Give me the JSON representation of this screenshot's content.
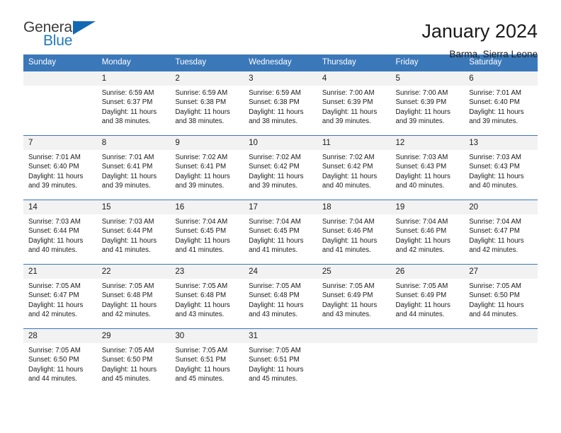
{
  "logo": {
    "text_primary": "General",
    "text_secondary": "Blue",
    "icon": "triangle-icon",
    "color_primary": "#3c3c3c",
    "color_secondary": "#2079c3",
    "triangle_color": "#1268b3"
  },
  "header": {
    "title": "January 2024",
    "location": "Barma, Sierra Leone"
  },
  "theme": {
    "header_bg": "#3b78b9",
    "header_text": "#ffffff",
    "daynum_bg": "#f2f2f2",
    "cell_bg": "#ffffff",
    "row_border": "#3b78b9"
  },
  "weekdays": [
    "Sunday",
    "Monday",
    "Tuesday",
    "Wednesday",
    "Thursday",
    "Friday",
    "Saturday"
  ],
  "labels": {
    "sunrise_prefix": "Sunrise:",
    "sunset_prefix": "Sunset:",
    "daylight_prefix": "Daylight:"
  },
  "weeks": [
    [
      {
        "day": "",
        "line1": "",
        "line2": "",
        "line3": "",
        "line4": "",
        "blank": true
      },
      {
        "day": "1",
        "line1": "Sunrise: 6:59 AM",
        "line2": "Sunset: 6:37 PM",
        "line3": "Daylight: 11 hours",
        "line4": "and 38 minutes."
      },
      {
        "day": "2",
        "line1": "Sunrise: 6:59 AM",
        "line2": "Sunset: 6:38 PM",
        "line3": "Daylight: 11 hours",
        "line4": "and 38 minutes."
      },
      {
        "day": "3",
        "line1": "Sunrise: 6:59 AM",
        "line2": "Sunset: 6:38 PM",
        "line3": "Daylight: 11 hours",
        "line4": "and 38 minutes."
      },
      {
        "day": "4",
        "line1": "Sunrise: 7:00 AM",
        "line2": "Sunset: 6:39 PM",
        "line3": "Daylight: 11 hours",
        "line4": "and 39 minutes."
      },
      {
        "day": "5",
        "line1": "Sunrise: 7:00 AM",
        "line2": "Sunset: 6:39 PM",
        "line3": "Daylight: 11 hours",
        "line4": "and 39 minutes."
      },
      {
        "day": "6",
        "line1": "Sunrise: 7:01 AM",
        "line2": "Sunset: 6:40 PM",
        "line3": "Daylight: 11 hours",
        "line4": "and 39 minutes."
      }
    ],
    [
      {
        "day": "7",
        "line1": "Sunrise: 7:01 AM",
        "line2": "Sunset: 6:40 PM",
        "line3": "Daylight: 11 hours",
        "line4": "and 39 minutes."
      },
      {
        "day": "8",
        "line1": "Sunrise: 7:01 AM",
        "line2": "Sunset: 6:41 PM",
        "line3": "Daylight: 11 hours",
        "line4": "and 39 minutes."
      },
      {
        "day": "9",
        "line1": "Sunrise: 7:02 AM",
        "line2": "Sunset: 6:41 PM",
        "line3": "Daylight: 11 hours",
        "line4": "and 39 minutes."
      },
      {
        "day": "10",
        "line1": "Sunrise: 7:02 AM",
        "line2": "Sunset: 6:42 PM",
        "line3": "Daylight: 11 hours",
        "line4": "and 39 minutes."
      },
      {
        "day": "11",
        "line1": "Sunrise: 7:02 AM",
        "line2": "Sunset: 6:42 PM",
        "line3": "Daylight: 11 hours",
        "line4": "and 40 minutes."
      },
      {
        "day": "12",
        "line1": "Sunrise: 7:03 AM",
        "line2": "Sunset: 6:43 PM",
        "line3": "Daylight: 11 hours",
        "line4": "and 40 minutes."
      },
      {
        "day": "13",
        "line1": "Sunrise: 7:03 AM",
        "line2": "Sunset: 6:43 PM",
        "line3": "Daylight: 11 hours",
        "line4": "and 40 minutes."
      }
    ],
    [
      {
        "day": "14",
        "line1": "Sunrise: 7:03 AM",
        "line2": "Sunset: 6:44 PM",
        "line3": "Daylight: 11 hours",
        "line4": "and 40 minutes."
      },
      {
        "day": "15",
        "line1": "Sunrise: 7:03 AM",
        "line2": "Sunset: 6:44 PM",
        "line3": "Daylight: 11 hours",
        "line4": "and 41 minutes."
      },
      {
        "day": "16",
        "line1": "Sunrise: 7:04 AM",
        "line2": "Sunset: 6:45 PM",
        "line3": "Daylight: 11 hours",
        "line4": "and 41 minutes."
      },
      {
        "day": "17",
        "line1": "Sunrise: 7:04 AM",
        "line2": "Sunset: 6:45 PM",
        "line3": "Daylight: 11 hours",
        "line4": "and 41 minutes."
      },
      {
        "day": "18",
        "line1": "Sunrise: 7:04 AM",
        "line2": "Sunset: 6:46 PM",
        "line3": "Daylight: 11 hours",
        "line4": "and 41 minutes."
      },
      {
        "day": "19",
        "line1": "Sunrise: 7:04 AM",
        "line2": "Sunset: 6:46 PM",
        "line3": "Daylight: 11 hours",
        "line4": "and 42 minutes."
      },
      {
        "day": "20",
        "line1": "Sunrise: 7:04 AM",
        "line2": "Sunset: 6:47 PM",
        "line3": "Daylight: 11 hours",
        "line4": "and 42 minutes."
      }
    ],
    [
      {
        "day": "21",
        "line1": "Sunrise: 7:05 AM",
        "line2": "Sunset: 6:47 PM",
        "line3": "Daylight: 11 hours",
        "line4": "and 42 minutes."
      },
      {
        "day": "22",
        "line1": "Sunrise: 7:05 AM",
        "line2": "Sunset: 6:48 PM",
        "line3": "Daylight: 11 hours",
        "line4": "and 42 minutes."
      },
      {
        "day": "23",
        "line1": "Sunrise: 7:05 AM",
        "line2": "Sunset: 6:48 PM",
        "line3": "Daylight: 11 hours",
        "line4": "and 43 minutes."
      },
      {
        "day": "24",
        "line1": "Sunrise: 7:05 AM",
        "line2": "Sunset: 6:48 PM",
        "line3": "Daylight: 11 hours",
        "line4": "and 43 minutes."
      },
      {
        "day": "25",
        "line1": "Sunrise: 7:05 AM",
        "line2": "Sunset: 6:49 PM",
        "line3": "Daylight: 11 hours",
        "line4": "and 43 minutes."
      },
      {
        "day": "26",
        "line1": "Sunrise: 7:05 AM",
        "line2": "Sunset: 6:49 PM",
        "line3": "Daylight: 11 hours",
        "line4": "and 44 minutes."
      },
      {
        "day": "27",
        "line1": "Sunrise: 7:05 AM",
        "line2": "Sunset: 6:50 PM",
        "line3": "Daylight: 11 hours",
        "line4": "and 44 minutes."
      }
    ],
    [
      {
        "day": "28",
        "line1": "Sunrise: 7:05 AM",
        "line2": "Sunset: 6:50 PM",
        "line3": "Daylight: 11 hours",
        "line4": "and 44 minutes."
      },
      {
        "day": "29",
        "line1": "Sunrise: 7:05 AM",
        "line2": "Sunset: 6:50 PM",
        "line3": "Daylight: 11 hours",
        "line4": "and 45 minutes."
      },
      {
        "day": "30",
        "line1": "Sunrise: 7:05 AM",
        "line2": "Sunset: 6:51 PM",
        "line3": "Daylight: 11 hours",
        "line4": "and 45 minutes."
      },
      {
        "day": "31",
        "line1": "Sunrise: 7:05 AM",
        "line2": "Sunset: 6:51 PM",
        "line3": "Daylight: 11 hours",
        "line4": "and 45 minutes."
      },
      {
        "day": "",
        "line1": "",
        "line2": "",
        "line3": "",
        "line4": "",
        "blank": true
      },
      {
        "day": "",
        "line1": "",
        "line2": "",
        "line3": "",
        "line4": "",
        "blank": true
      },
      {
        "day": "",
        "line1": "",
        "line2": "",
        "line3": "",
        "line4": "",
        "blank": true
      }
    ]
  ]
}
